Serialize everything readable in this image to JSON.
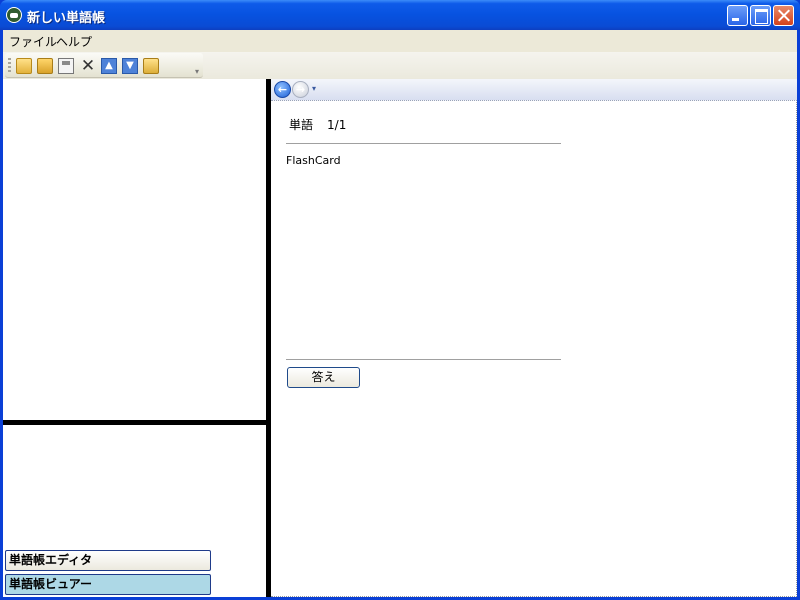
{
  "window": {
    "title": "新しい単語帳",
    "title_icon": "app-face-icon",
    "controls": [
      "minimize-icon",
      "maximize-icon",
      "close-icon"
    ]
  },
  "menu": {
    "file": "ファイル",
    "help": "ヘルプ"
  },
  "toolbar": {
    "icons": [
      "new-icon",
      "open-icon",
      "save-icon",
      "delete-icon",
      "move-up-icon",
      "move-down-icon",
      "copy-icon"
    ],
    "delete_glyph": "✕",
    "up_glyph": "▲",
    "down_glyph": "▼",
    "overflow_glyph": "▾"
  },
  "sidebar": {
    "buttons": [
      {
        "label": "単語帳エディタ",
        "selected": false
      },
      {
        "label": "単語帳ビュアー",
        "selected": true
      }
    ],
    "selected_color": "#add8e6"
  },
  "viewer": {
    "nav": {
      "back_glyph": "←",
      "forward_glyph": "→",
      "dropdown_glyph": "▾"
    },
    "card": {
      "header_label": "単語",
      "counter": "1/1",
      "word": "FlashCard",
      "answer_button": "答え"
    }
  }
}
